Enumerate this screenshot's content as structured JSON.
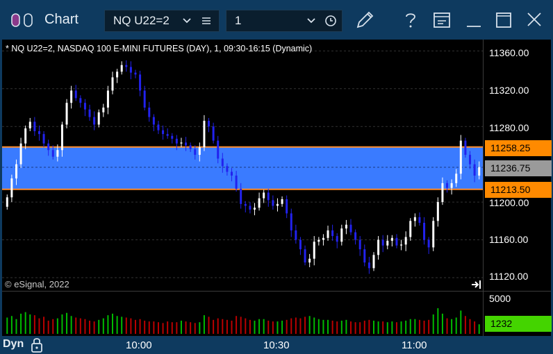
{
  "titlebar": {
    "app_title": "Chart",
    "symbol": "NQ U22=2",
    "interval": "1",
    "icons": [
      "toggle-icon",
      "chevron-down-icon",
      "list-icon",
      "chevron-down-icon",
      "clock-icon",
      "pencil-icon",
      "help-icon",
      "layout-icon",
      "minimize-icon",
      "maximize-icon",
      "close-icon"
    ]
  },
  "chart": {
    "header": "* NQ U22=2, NASDAQ 100 E-MINI FUTURES (DAY), 1, 09:30-16:15 (Dynamic)",
    "copyright": "© eSignal, 2022",
    "colors": {
      "up": "#ffffff",
      "down": "#2222ee",
      "band": "#3a7bff",
      "band_border": "#ff8c2a",
      "grid": "#333333",
      "volume_up": "#00bb00",
      "volume_down": "#bb0000"
    },
    "price_axis": [
      "11360.00",
      "11320.00",
      "11280.00",
      "11200.00",
      "11160.00",
      "11120.00"
    ],
    "price_tags": {
      "upper": {
        "text": "11258.25",
        "color": "#ff8a00"
      },
      "last": {
        "text": "11236.75",
        "color": "#9a9a9a"
      },
      "lower": {
        "text": "11213.50",
        "color": "#ff8a00"
      }
    },
    "volume_axis": {
      "max_label": "5000",
      "last_label": "1232",
      "last_color": "#44d400"
    },
    "time_axis": [
      "10:00",
      "10:30",
      "11:00"
    ]
  },
  "chart_data": {
    "type": "candlestick",
    "title": "* NQ U22=2, NASDAQ 100 E-MINI FUTURES (DAY), 1, 09:30-16:15 (Dynamic)",
    "ylim": [
      11106,
      11372
    ],
    "band": {
      "upper": 11258.25,
      "lower": 11213.5
    },
    "last_price": 11236.75,
    "last_volume": 1232,
    "volume_max_label": 5000,
    "x_tick_labels": [
      "10:00",
      "10:30",
      "11:00"
    ],
    "closes": [
      11205,
      11225,
      11240,
      11262,
      11278,
      11285,
      11275,
      11272,
      11262,
      11255,
      11248,
      11255,
      11282,
      11305,
      11318,
      11310,
      11305,
      11298,
      11290,
      11282,
      11295,
      11300,
      11318,
      11332,
      11338,
      11345,
      11343,
      11337,
      11335,
      11318,
      11300,
      11290,
      11282,
      11276,
      11272,
      11270,
      11267,
      11262,
      11263,
      11260,
      11256,
      11250,
      11258,
      11286,
      11280,
      11265,
      11246,
      11238,
      11232,
      11228,
      11214,
      11198,
      11196,
      11192,
      11194,
      11204,
      11210,
      11202,
      11196,
      11198,
      11203,
      11188,
      11170,
      11160,
      11150,
      11136,
      11140,
      11158,
      11160,
      11162,
      11170,
      11164,
      11158,
      11172,
      11176,
      11168,
      11160,
      11150,
      11136,
      11130,
      11144,
      11160,
      11154,
      11159,
      11162,
      11154,
      11155,
      11163,
      11180,
      11184,
      11178,
      11160,
      11152,
      11180,
      11200,
      11220,
      11215,
      11220,
      11230,
      11265,
      11250,
      11240,
      11228,
      11237
    ],
    "volumes": [
      2100,
      2300,
      1900,
      2600,
      2800,
      2500,
      2400,
      2000,
      2200,
      1700,
      1900,
      2000,
      2500,
      2700,
      2300,
      2100,
      2000,
      1900,
      1700,
      1600,
      1800,
      2000,
      2400,
      2600,
      2300,
      2200,
      2100,
      2000,
      1800,
      1900,
      1700,
      1600,
      1600,
      1500,
      1400,
      1600,
      1500,
      1500,
      1700,
      1600,
      1500,
      1400,
      1500,
      2400,
      2200,
      1800,
      2000,
      1900,
      1800,
      1700,
      2300,
      2200,
      2000,
      1800,
      1700,
      1900,
      1900,
      1700,
      1600,
      1600,
      1700,
      1800,
      2000,
      2100,
      2000,
      2200,
      2300,
      2100,
      1900,
      1800,
      1800,
      1700,
      1600,
      1700,
      1800,
      1600,
      1500,
      1500,
      1700,
      1800,
      1700,
      1600,
      1600,
      1500,
      1600,
      1500,
      1600,
      1700,
      1900,
      1900,
      1800,
      1700,
      1800,
      2500,
      3300,
      2600,
      2000,
      1900,
      2100,
      3000,
      2300,
      1900,
      1600,
      1232
    ]
  }
}
